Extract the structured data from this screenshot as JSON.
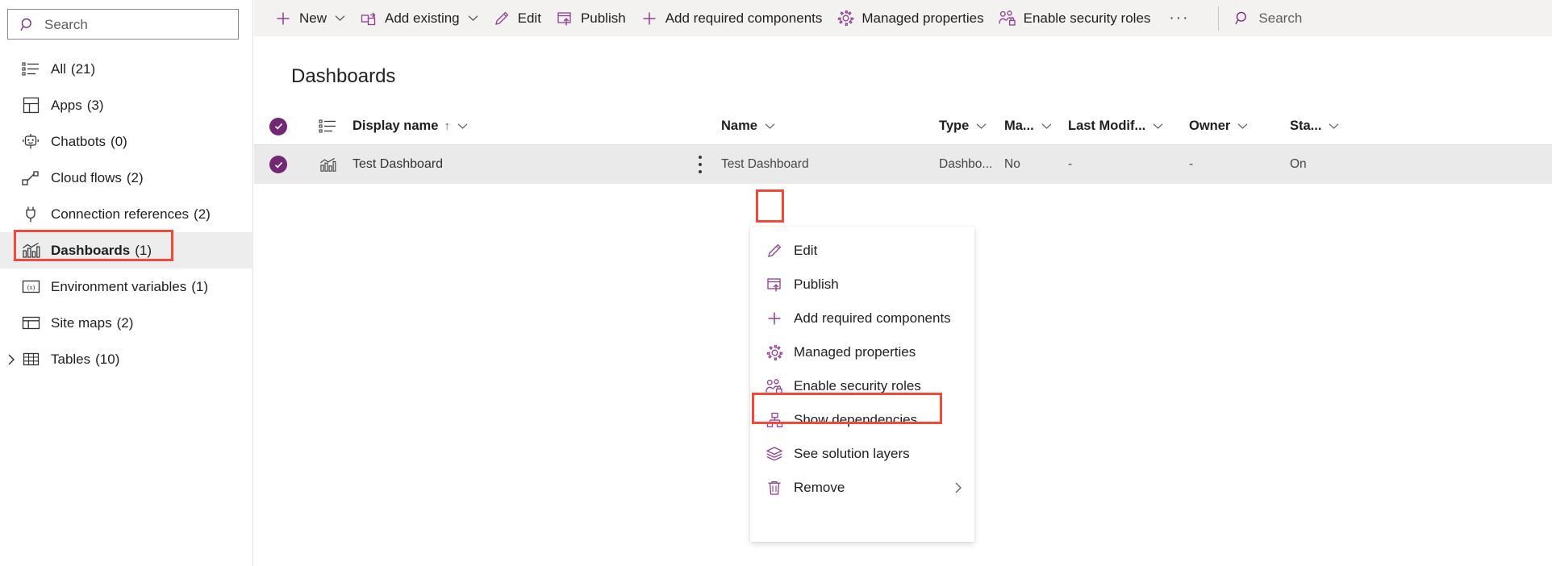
{
  "sidebar": {
    "search": {
      "placeholder": "Search",
      "icon": "search-icon"
    },
    "items": [
      {
        "label": "All",
        "count": "(21)",
        "icon": "list-icon",
        "selected": false,
        "expandable": false
      },
      {
        "label": "Apps",
        "count": "(3)",
        "icon": "apps-grid-icon",
        "selected": false,
        "expandable": false
      },
      {
        "label": "Chatbots",
        "count": "(0)",
        "icon": "chatbot-icon",
        "selected": false,
        "expandable": false
      },
      {
        "label": "Cloud flows",
        "count": "(2)",
        "icon": "cloud-flow-icon",
        "selected": false,
        "expandable": false
      },
      {
        "label": "Connection references",
        "count": "(2)",
        "icon": "connection-plug-icon",
        "selected": false,
        "expandable": false
      },
      {
        "label": "Dashboards",
        "count": "(1)",
        "icon": "dashboard-chart-icon",
        "selected": true,
        "expandable": false
      },
      {
        "label": "Environment variables",
        "count": "(1)",
        "icon": "environment-variable-icon",
        "selected": false,
        "expandable": false
      },
      {
        "label": "Site maps",
        "count": "(2)",
        "icon": "sitemap-layout-icon",
        "selected": false,
        "expandable": false
      },
      {
        "label": "Tables",
        "count": "(10)",
        "icon": "table-grid-icon",
        "selected": false,
        "expandable": true
      }
    ]
  },
  "commandbar": {
    "items": [
      {
        "label": "New",
        "icon": "plus-icon",
        "chevron": true
      },
      {
        "label": "Add existing",
        "icon": "add-existing-icon",
        "chevron": true
      },
      {
        "label": "Edit",
        "icon": "pencil-icon",
        "chevron": false
      },
      {
        "label": "Publish",
        "icon": "publish-icon",
        "chevron": false
      },
      {
        "label": "Add required components",
        "icon": "plus-icon",
        "chevron": false
      },
      {
        "label": "Managed properties",
        "icon": "gear-icon",
        "chevron": false
      },
      {
        "label": "Enable security roles",
        "icon": "security-roles-icon",
        "chevron": false
      },
      {
        "label": "···",
        "icon": "overflow-ellipsis-icon",
        "chevron": false
      }
    ],
    "search": {
      "label": "Search",
      "icon": "search-icon"
    }
  },
  "main": {
    "page_title": "Dashboards",
    "grid": {
      "columns": [
        {
          "key": "display_name",
          "label": "Display name",
          "sorted": "↑",
          "chevron": true
        },
        {
          "key": "name",
          "label": "Name",
          "sorted": "",
          "chevron": true
        },
        {
          "key": "type",
          "label": "Type",
          "sorted": "",
          "chevron": true
        },
        {
          "key": "managed",
          "label": "Ma...",
          "sorted": "",
          "chevron": true
        },
        {
          "key": "last_modified",
          "label": "Last Modif...",
          "sorted": "",
          "chevron": true
        },
        {
          "key": "owner",
          "label": "Owner",
          "sorted": "",
          "chevron": true
        },
        {
          "key": "status",
          "label": "Sta...",
          "sorted": "",
          "chevron": true
        }
      ],
      "rows": [
        {
          "selected": true,
          "row_icon": "dashboard-chart-icon",
          "display_name": "Test Dashboard",
          "name": "Test Dashboard",
          "type": "Dashbo...",
          "managed": "No",
          "last_modified": "-",
          "owner": "-",
          "status": "On"
        }
      ]
    }
  },
  "context_menu": {
    "items": [
      {
        "label": "Edit",
        "icon": "pencil-icon",
        "submenu": false,
        "highlighted": false
      },
      {
        "label": "Publish",
        "icon": "publish-icon",
        "submenu": false,
        "highlighted": false
      },
      {
        "label": "Add required components",
        "icon": "plus-icon",
        "submenu": false,
        "highlighted": false
      },
      {
        "label": "Managed properties",
        "icon": "gear-icon",
        "submenu": false,
        "highlighted": false
      },
      {
        "label": "Enable security roles",
        "icon": "security-roles-icon",
        "submenu": false,
        "highlighted": true
      },
      {
        "label": "Show dependencies",
        "icon": "dependencies-icon",
        "submenu": false,
        "highlighted": false
      },
      {
        "label": "See solution layers",
        "icon": "layers-icon",
        "submenu": false,
        "highlighted": false
      },
      {
        "label": "Remove",
        "icon": "trash-icon",
        "submenu": true,
        "highlighted": false
      }
    ]
  },
  "annotations": {
    "highlight_color": "#f4483b",
    "accent_color": "#742774",
    "boxes": [
      {
        "name": "sidebar-dashboards-highlight",
        "target": "Dashboards (1)"
      },
      {
        "name": "row-kebab-highlight",
        "target": "row context menu button"
      },
      {
        "name": "menu-enable-security-roles-highlight",
        "target": "Enable security roles"
      }
    ]
  }
}
